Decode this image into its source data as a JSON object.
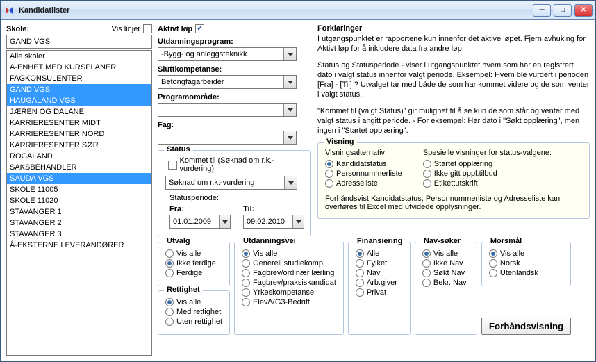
{
  "title": "Kandidatlister",
  "left": {
    "skole_label": "Skole:",
    "vis_linjer": "Vis linjer",
    "skole_value": "GAND VGS",
    "items": [
      {
        "label": "Alle skoler",
        "sel": false
      },
      {
        "label": "A-ENHET MED KURSPLANER",
        "sel": false
      },
      {
        "label": "FAGKONSULENTER",
        "sel": false
      },
      {
        "label": "GAND VGS",
        "sel": true
      },
      {
        "label": "HAUGALAND VGS",
        "sel": true
      },
      {
        "label": "JÆREN OG DALANE",
        "sel": false
      },
      {
        "label": "KARRIERESENTER MIDT",
        "sel": false
      },
      {
        "label": "KARRIERESENTER NORD",
        "sel": false
      },
      {
        "label": "KARRIERESENTER SØR",
        "sel": false
      },
      {
        "label": "ROGALAND",
        "sel": false
      },
      {
        "label": "SAKSBEHANDLER",
        "sel": false
      },
      {
        "label": "SAUDA VGS",
        "sel": true
      },
      {
        "label": "SKOLE 11005",
        "sel": false
      },
      {
        "label": "SKOLE 11020",
        "sel": false
      },
      {
        "label": "STAVANGER 1",
        "sel": false
      },
      {
        "label": "STAVANGER 2",
        "sel": false
      },
      {
        "label": "STAVANGER 3",
        "sel": false
      },
      {
        "label": "Å-EKSTERNE LEVERANDØRER",
        "sel": false
      }
    ]
  },
  "filters": {
    "aktivt_lop": "Aktivt løp",
    "aktivt_checked": "✓",
    "utdanningsprogram_label": "Utdanningsprogram:",
    "utdanningsprogram_value": "-Bygg- og anleggsteknikk",
    "sluttkompetanse_label": "Sluttkompetanse:",
    "sluttkompetanse_value": "Betongfagarbeider",
    "programomrade_label": "Programområde:",
    "programomrade_value": "",
    "fag_label": "Fag:",
    "fag_value": ""
  },
  "status": {
    "legend": "Status",
    "kommet_til": "Kommet til (Søknad om r.k.-vurdering)",
    "combo_value": "Søknad om r.k.-vurdering",
    "periode_label": "Statusperiode:",
    "fra_label": "Fra:",
    "fra_value": "01.01.2009",
    "til_label": "Til:",
    "til_value": "09.02.2010"
  },
  "forklaringer": {
    "title": "Forklaringer",
    "p1": "I utgangspunktet er rapportene kun innenfor det aktive løpet. Fjern avhuking for Aktivt løp for å inkludere data fra andre løp.",
    "p2": "Status og Statusperiode - viser i utgangspunktet hvem som har en registrert dato i valgt status innenfor valgt periode. Eksempel: Hvem ble vurdert i perioden [Fra] - [Til] ? Utvalget tar med både de som har kommet videre og de som venter i valgt status.",
    "p3": "\"Kommet til (valgt Status)\" gir mulighet til å se kun de som står og venter med valgt status i angitt periode. - For eksempel: Har dato i \"Søkt opplæring\", men ingen i \"Startet opplæring\"."
  },
  "visning": {
    "legend": "Visning",
    "alt_label": "Visningsalternativ:",
    "spes_label": "Spesielle visninger for status-valgene:",
    "left_opts": [
      {
        "label": "Kandidatstatus",
        "sel": true
      },
      {
        "label": "Personnummerliste",
        "sel": false
      },
      {
        "label": "Adresseliste",
        "sel": false
      }
    ],
    "right_opts": [
      {
        "label": "Startet opplæring",
        "sel": false
      },
      {
        "label": "Ikke gitt oppl.tilbud",
        "sel": false
      },
      {
        "label": "Etikettutskrift",
        "sel": false
      }
    ],
    "footnote": "Forhåndsvist Kandidatstatus, Personnummerliste og Adresseliste kan overføres til Excel med utvidede opplysninger."
  },
  "bottom": {
    "utvalg": {
      "legend": "Utvalg",
      "opts": [
        {
          "label": "Vis alle",
          "sel": false
        },
        {
          "label": "Ikke ferdige",
          "sel": true
        },
        {
          "label": "Ferdige",
          "sel": false
        }
      ]
    },
    "rettighet": {
      "legend": "Rettighet",
      "opts": [
        {
          "label": "Vis alle",
          "sel": true
        },
        {
          "label": "Med rettighet",
          "sel": false
        },
        {
          "label": "Uten rettighet",
          "sel": false
        }
      ]
    },
    "utdanningsvei": {
      "legend": "Utdanningsvei",
      "opts": [
        {
          "label": "Vis alle",
          "sel": true
        },
        {
          "label": "Generell studiekomp.",
          "sel": false
        },
        {
          "label": "Fagbrev/ordinær lærling",
          "sel": false
        },
        {
          "label": "Fagbrev/praksiskandidat",
          "sel": false
        },
        {
          "label": "Yrkeskompetanse",
          "sel": false
        },
        {
          "label": "Elev/VG3-Bedrift",
          "sel": false
        }
      ]
    },
    "finansiering": {
      "legend": "Finansiering",
      "opts": [
        {
          "label": "Alle",
          "sel": true
        },
        {
          "label": "Fylket",
          "sel": false
        },
        {
          "label": "Nav",
          "sel": false
        },
        {
          "label": "Arb.giver",
          "sel": false
        },
        {
          "label": "Privat",
          "sel": false
        }
      ]
    },
    "navsoker": {
      "legend": "Nav-søker",
      "opts": [
        {
          "label": "Vis alle",
          "sel": true
        },
        {
          "label": "Ikke Nav",
          "sel": false
        },
        {
          "label": "Søkt Nav",
          "sel": false
        },
        {
          "label": "Bekr. Nav",
          "sel": false
        }
      ]
    },
    "morsmal": {
      "legend": "Morsmål",
      "opts": [
        {
          "label": "Vis alle",
          "sel": true
        },
        {
          "label": "Norsk",
          "sel": false
        },
        {
          "label": "Utenlandsk",
          "sel": false
        }
      ]
    },
    "preview_btn": "Forhåndsvisning"
  }
}
